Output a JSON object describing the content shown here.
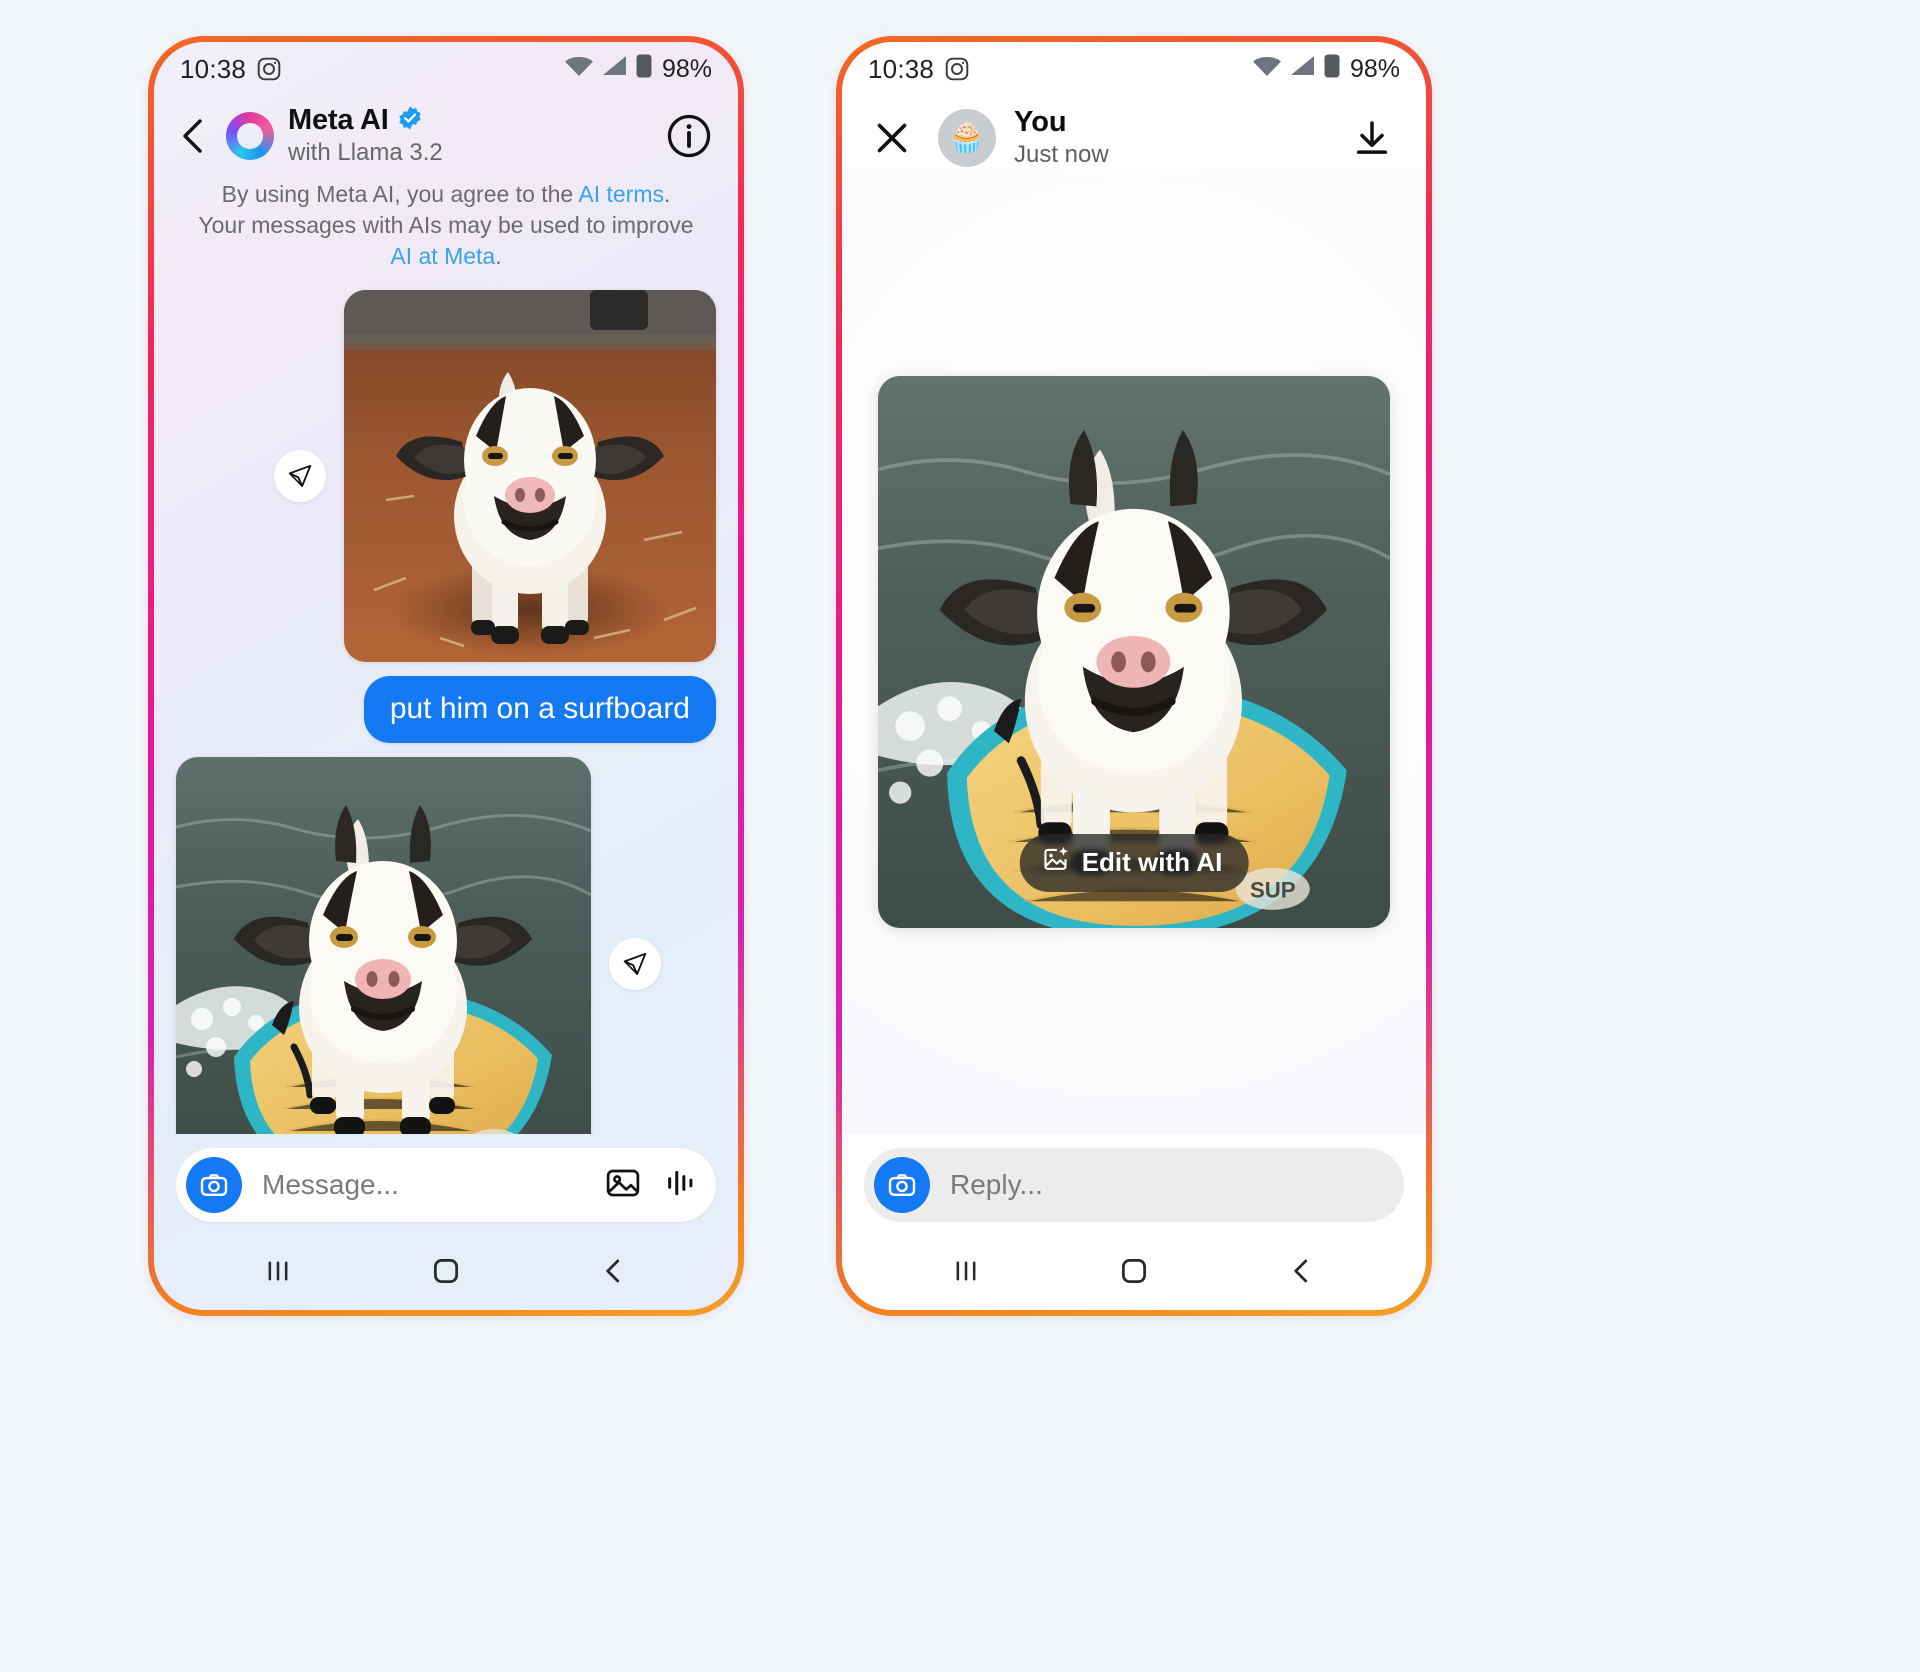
{
  "left_phone": {
    "status": {
      "time": "10:38",
      "app_icon": "instagram-icon",
      "battery": "98%",
      "wifi_icon": "wifi-icon",
      "signal_icon": "signal-icon",
      "battery_icon": "battery-icon"
    },
    "header": {
      "back_icon": "back-chevron-icon",
      "avatar_icon": "meta-ai-ring-icon",
      "title": "Meta AI",
      "verified_icon": "verified-badge-icon",
      "subtitle": "with Llama 3.2",
      "info_icon": "info-circle-icon"
    },
    "disclaimer": {
      "part1": "By using Meta AI, you agree to the ",
      "link1": "AI terms",
      "part2": ". Your messages with AIs may be used to improve ",
      "link2": "AI at Meta",
      "part3": "."
    },
    "messages": [
      {
        "type": "image-sent",
        "alt": "photo of a white goat standing on red dirt",
        "send_icon": "send-paper-plane-icon"
      },
      {
        "type": "text-sent",
        "text": "put him on a surfboard"
      },
      {
        "type": "image-received",
        "alt": "AI generated image of goat riding a surfboard on a wave",
        "send_icon": "send-paper-plane-icon"
      }
    ],
    "reactions": [
      {
        "name": "thumbs-up-icon"
      },
      {
        "name": "thumbs-down-icon"
      }
    ],
    "composer": {
      "camera_icon": "camera-icon",
      "placeholder": "Message...",
      "gallery_icon": "image-gallery-icon",
      "audio_icon": "audio-waveform-icon"
    },
    "navbar": [
      {
        "name": "recents-icon"
      },
      {
        "name": "home-icon"
      },
      {
        "name": "back-icon"
      }
    ]
  },
  "right_phone": {
    "status": {
      "time": "10:38",
      "app_icon": "instagram-icon",
      "battery": "98%",
      "wifi_icon": "wifi-icon",
      "signal_icon": "signal-icon",
      "battery_icon": "battery-icon"
    },
    "header": {
      "close_icon": "close-x-icon",
      "avatar_emoji": "🧁",
      "name": "You",
      "time": "Just now",
      "download_icon": "download-icon"
    },
    "story": {
      "photo_alt": "AI generated image of goat riding a surfboard on a wave",
      "edit_button_label": "Edit with AI",
      "edit_button_icon": "sparkle-image-icon"
    },
    "composer": {
      "camera_icon": "camera-icon",
      "placeholder": "Reply..."
    },
    "navbar": [
      {
        "name": "recents-icon"
      },
      {
        "name": "home-icon"
      },
      {
        "name": "back-icon"
      }
    ]
  },
  "colors": {
    "accent_blue": "#1479f2",
    "link_blue": "#3aa3e8",
    "frame_pink": "#e6159c",
    "frame_orange": "#f26b21",
    "page_bg": "#f2f5fa"
  }
}
